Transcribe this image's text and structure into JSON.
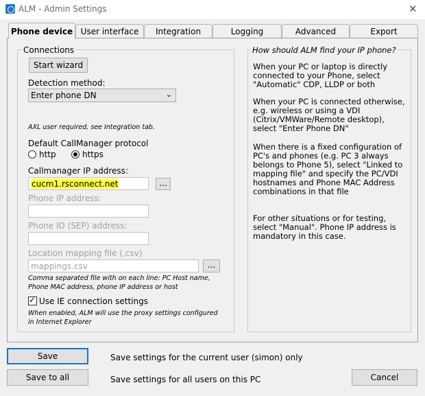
{
  "window": {
    "title": "ALM - Admin Settings"
  },
  "tabs": [
    {
      "label": "Phone device"
    },
    {
      "label": "User interface"
    },
    {
      "label": "Integration"
    },
    {
      "label": "Logging"
    },
    {
      "label": "Advanced"
    },
    {
      "label": "Export"
    }
  ],
  "connections": {
    "group_label": "Connections",
    "start_wizard": "Start wizard",
    "detection_label": "Detection method:",
    "detection_value": "Enter phone DN",
    "axl_note": "AXL user required, see Integration tab.",
    "protocol_label": "Default CallManager protocol",
    "protocol_options": [
      "http",
      "https"
    ],
    "protocol_selected": "https",
    "cm_ip_label": "Callmanager IP address:",
    "cm_ip_value": "cucm1.rsconnect.net",
    "browse_label": "...",
    "phone_ip_label": "Phone IP address:",
    "phone_id_label": "Phone ID (SEP) address:",
    "location_label": "Location mapping file (.csv)",
    "location_placeholder": "mappings.csv",
    "location_note": "Comma separated file with on each line: PC Host name, Phone MAC address, phone IP address or host",
    "ie_label": "Use IE connection settings",
    "ie_checked": true,
    "ie_note": "When enabled, ALM will use the proxy settings configured in Internet Explorer"
  },
  "help": {
    "title": "How should ALM find your IP phone?",
    "paragraphs": [
      "When your PC or laptop is directly connected to your Phone, select \"Automatic\" CDP, LLDP or both",
      "When your PC is connected otherwise, e.g. wireless or using a VDI (Citrix/VMWare/Remote desktop), select \"Enter Phone DN\"",
      "When there is a fixed configuration of PC's and phones (e.g. PC 3 always belongs to Phone 5), select \"Linked to mapping file\" and specify the PC/VDI hostnames and Phone MAC Address combinations in that file",
      "For other situations or for testing, select \"Manual\". Phone IP address is mandatory in this case."
    ]
  },
  "footer": {
    "save_label": "Save",
    "save_desc": "Save settings for the current user (simon) only",
    "save_all_label": "Save to all",
    "save_all_desc": "Save settings for all users on this PC",
    "cancel_label": "Cancel"
  },
  "colors": {
    "highlight": "#ffff33",
    "focus_border": "#1a74c8"
  }
}
